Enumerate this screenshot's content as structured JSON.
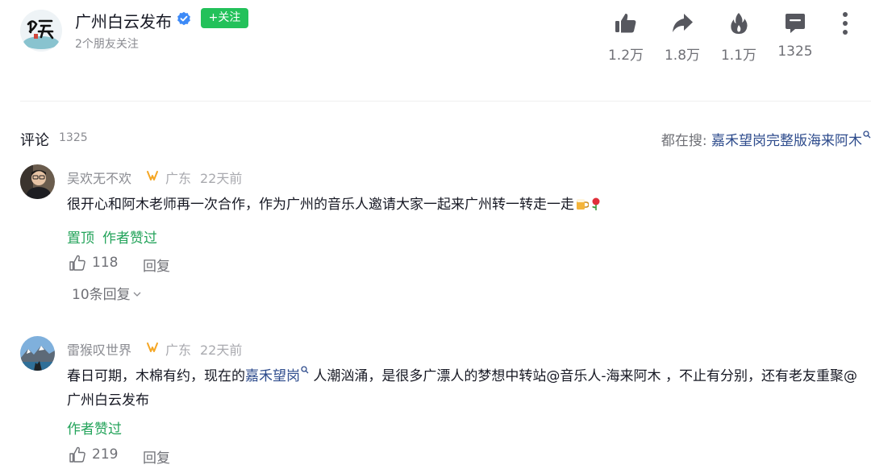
{
  "header": {
    "author_name": "广州白云发布",
    "follow_label": "+关注",
    "friends_note": "2个朋友关注",
    "stats": {
      "likes": "1.2万",
      "shares": "1.8万",
      "hot": "1.1万",
      "comments": "1325"
    }
  },
  "comments_section": {
    "title": "评论",
    "count": "1325",
    "search_label": "都在搜:",
    "search_term": "嘉禾望岗完整版海来阿木"
  },
  "comments": [
    {
      "username": "吴欢无不欢",
      "location": "广东",
      "time": "22天前",
      "text": "很开心和阿木老师再一次合作，作为广州的音乐人邀请大家一起来广州转一转走一走",
      "tag_pinned": "置顶",
      "tag_author_liked": "作者赞过",
      "likes": "118",
      "reply_label": "回复",
      "more_replies": "10条回复"
    },
    {
      "username": "雷猴叹世界",
      "location": "广东",
      "time": "22天前",
      "text_before": "春日可期，木棉有约，现在的",
      "text_link": "嘉禾望岗",
      "text_after": " 人潮汹涌，是很多广漂人的梦想中转站@音乐人-海来阿木 ，不止有分别，还有老友重聚@广州白云发布",
      "tag_author_liked": "作者赞过",
      "likes": "219",
      "reply_label": "回复"
    }
  ],
  "colors": {
    "follow_green": "#23c15a",
    "tag_green": "#23a35a",
    "link_blue": "#2d4b8c",
    "verified_blue": "#3d8af7",
    "badge_orange": "#f5a623"
  }
}
